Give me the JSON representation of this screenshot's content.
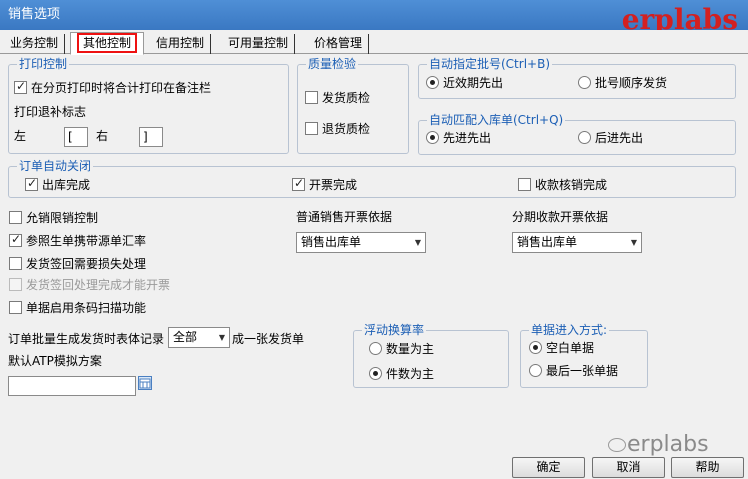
{
  "window": {
    "title": "销售选项"
  },
  "watermark": {
    "top": "erplabs",
    "bottom": "erplabs"
  },
  "tabs": [
    {
      "label": "业务控制"
    },
    {
      "label": "其他控制"
    },
    {
      "label": "信用控制"
    },
    {
      "label": "可用量控制"
    },
    {
      "label": "价格管理"
    }
  ],
  "print_control": {
    "legend": "打印控制",
    "merge_label": "在分页打印时将合计打印在备注栏",
    "fill_mark_label": "打印退补标志",
    "left_label": "左",
    "left_value": "[",
    "right_label": "右",
    "right_value": "]"
  },
  "quality": {
    "legend": "质量检验",
    "ship_label": "发货质检",
    "return_label": "退货质检"
  },
  "batch": {
    "legend": "自动指定批号(Ctrl+B)",
    "opt1": "近效期先出",
    "opt2": "批号顺序发货"
  },
  "match": {
    "legend": "自动匹配入库单(Ctrl+Q)",
    "opt1": "先进先出",
    "opt2": "后进先出"
  },
  "auto_close": {
    "legend": "订单自动关闭",
    "out_label": "出库完成",
    "invoice_label": "开票完成",
    "receipt_label": "收款核销完成"
  },
  "options": {
    "allow_limit": "允销限销控制",
    "ref_source": "参照生单携带源单汇率",
    "loss_process": "发货签回需要损失处理",
    "sign_invoice": "发货签回处理完成才能开票",
    "barcode": "单据启用条码扫描功能"
  },
  "normal_invoice": {
    "label": "普通销售开票依据",
    "value": "销售出库单"
  },
  "install_invoice": {
    "label": "分期收款开票依据",
    "value": "销售出库单"
  },
  "batch_gen": {
    "prefix": "订单批量生成发货时表体记录",
    "value": "全部",
    "suffix": "成一张发货单"
  },
  "atp": {
    "label": "默认ATP模拟方案",
    "value": ""
  },
  "float_rate": {
    "legend": "浮动换算率",
    "opt1": "数量为主",
    "opt2": "件数为主"
  },
  "doc_entry": {
    "legend": "单据进入方式:",
    "opt1": "空白单据",
    "opt2": "最后一张单据"
  },
  "buttons": {
    "ok": "确定",
    "cancel": "取消",
    "help": "帮助"
  }
}
